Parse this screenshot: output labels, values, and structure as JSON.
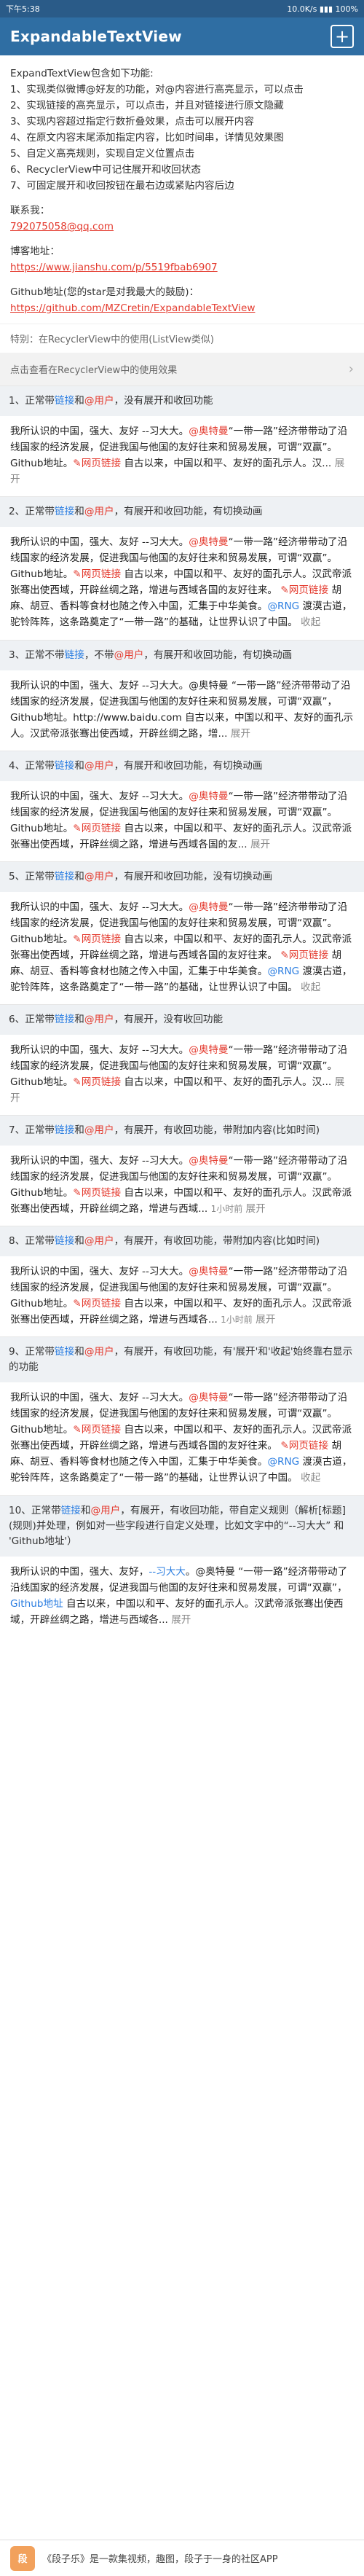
{
  "status": {
    "time": "下午5:38",
    "network": "10.0K/s",
    "battery": "100%"
  },
  "app": {
    "title": "ExpandableTextView"
  },
  "intro": {
    "heading": "ExpandTextView包含如下功能:",
    "lines": [
      "1、实现类似微博@好友的功能，对@内容进行高亮显示，可以点击",
      "2、实现链接的高亮显示，可以点击，并且对链接进行原文隐藏",
      "3、实现内容超过指定行数折叠效果，点击可以展开内容",
      "4、在原文内容末尾添加指定内容，比如时间串，详情见效果图",
      "5、自定义高亮规则，实现自定义位置点击",
      "6、RecyclerView中可记住展开和收回状态",
      "7、可固定展开和收回按钮在最右边或紧贴内容后边"
    ],
    "contact_label": "联系我：",
    "contact_email": "792075058@qq.com",
    "blog_label": "博客地址：",
    "blog_url": "https://www.jianshu.com/p/5519fbab6907",
    "github_label": "Github地址(您的star是对我最大的鼓励)：",
    "github_url": "https://github.com/MZCretin/ExpandableTextView"
  },
  "special_hint": "特别：在RecyclerView中的使用(ListView类似)",
  "rv_button": "点击查看在RecyclerView中的使用效果",
  "items": [
    {
      "hdr_prefix": "1、正常带",
      "hdr_link": "链接",
      "hdr_and": "和",
      "hdr_at": "@用户",
      "hdr_rest": "，没有展开和收回功能",
      "body_a": "我所认识的中国，强大、友好 --习大大。",
      "body_b": "@奥特曼",
      "body_c": "“一带一路”经济带带动了沿线国家的经济发展，促进我国与他国的友好往来和贸易发展，可谓“双赢”。Github地址。",
      "body_d": "网页链接",
      "body_e": "自古以来，中国以和平、友好的面孔示人。汉...",
      "body_tail": "展开"
    },
    {
      "hdr_prefix": "2、正常带",
      "hdr_link": "链接",
      "hdr_and": "和",
      "hdr_at": "@用户",
      "hdr_rest": "，有展开和收回功能，有切换动画",
      "body_a": "我所认识的中国，强大、友好 --习大大。",
      "body_b": "@奥特曼",
      "body_c": "“一带一路”经济带带动了沿线国家的经济发展，促进我国与他国的友好往来和贸易发展，可谓“双赢”。Github地址。",
      "body_d": "网页链接",
      "body_e": "自古以来，中国以和平、友好的面孔示人。汉武帝派张骞出使西域，开辟丝绸之路，增进与西域各国的友好往来。",
      "body_d2": "网页链接",
      "body_f": "胡麻、胡豆、香料等食材也随之传入中国，汇集于中华美食。",
      "body_g": "@RNG",
      "body_h": "渡漠古道，驼铃阵阵，这条路奠定了“一带一路”的基础，让世界认识了中国。",
      "body_tail": "收起"
    },
    {
      "hdr_prefix": "3、正常不带",
      "hdr_link": "链接",
      "hdr_and": "，不带",
      "hdr_at": "@用户",
      "hdr_rest": "，有展开和收回功能，有切换动画",
      "body_a": "我所认识的中国，强大、友好 --习大大。@奥特曼 “一带一路”经济带带动了沿线国家的经济发展，促进我国与他国的友好往来和贸易发展，可谓“双赢”，Github地址。http://www.baidu.com 自古以来，中国以和平、友好的面孔示人。汉武帝派张骞出使西域，开辟丝绸之路，增...",
      "body_tail": "展开"
    },
    {
      "hdr_prefix": "4、正常带",
      "hdr_link": "链接",
      "hdr_and": "和",
      "hdr_at": "@用户",
      "hdr_rest": "，有展开和收回功能，有切换动画",
      "body_a": "我所认识的中国，强大、友好 --习大大。",
      "body_b": "@奥特曼",
      "body_c": "“一带一路”经济带带动了沿线国家的经济发展，促进我国与他国的友好往来和贸易发展，可谓“双赢”。Github地址。",
      "body_d": "网页链接",
      "body_e": "自古以来，中国以和平、友好的面孔示人。汉武帝派张骞出使西域，开辟丝绸之路，增进与西域各国的友...",
      "body_tail": "展开"
    },
    {
      "hdr_prefix": "5、正常带",
      "hdr_link": "链接",
      "hdr_and": "和",
      "hdr_at": "@用户",
      "hdr_rest": "，有展开和收回功能，没有切换动画",
      "body_a": "我所认识的中国，强大、友好 --习大大。",
      "body_b": "@奥特曼",
      "body_c": "“一带一路”经济带带动了沿线国家的经济发展，促进我国与他国的友好往来和贸易发展，可谓“双赢”。Github地址。",
      "body_d": "网页链接",
      "body_e": "自古以来，中国以和平、友好的面孔示人。汉武帝派张骞出使西域，开辟丝绸之路，增进与西域各国的友好往来。",
      "body_d2": "网页链接",
      "body_f": "胡麻、胡豆、香料等食材也随之传入中国，汇集于中华美食。",
      "body_g": "@RNG",
      "body_h": "渡漠古道，驼铃阵阵，这条路奠定了“一带一路”的基础，让世界认识了中国。",
      "body_tail": "收起"
    },
    {
      "hdr_prefix": "6、正常带",
      "hdr_link": "链接",
      "hdr_and": "和",
      "hdr_at": "@用户",
      "hdr_rest": "，有展开，没有收回功能",
      "body_a": "我所认识的中国，强大、友好 --习大大。",
      "body_b": "@奥特曼",
      "body_c": "“一带一路”经济带带动了沿线国家的经济发展，促进我国与他国的友好往来和贸易发展，可谓“双赢”。Github地址。",
      "body_d": "网页链接",
      "body_e": "自古以来，中国以和平、友好的面孔示人。汉...",
      "body_tail": "展开"
    },
    {
      "hdr_prefix": "7、正常带",
      "hdr_link": "链接",
      "hdr_and": "和",
      "hdr_at": "@用户",
      "hdr_rest": "，有展开，有收回功能，带附加内容(比如时间)",
      "body_a": "我所认识的中国，强大、友好 --习大大。",
      "body_b": "@奥特曼",
      "body_c": "“一带一路”经济带带动了沿线国家的经济发展，促进我国与他国的友好往来和贸易发展，可谓“双赢”。Github地址。",
      "body_d": "网页链接",
      "body_e": "自古以来，中国以和平、友好的面孔示人。汉武帝派张骞出使西域，开辟丝绸之路，增进与西域...",
      "body_time": "1小时前",
      "body_tail": "展开"
    },
    {
      "hdr_prefix": "8、正常带",
      "hdr_link": "链接",
      "hdr_and": "和",
      "hdr_at": "@用户",
      "hdr_rest": "，有展开，有收回功能，带附加内容(比如时间)",
      "body_a": "我所认识的中国，强大、友好 --习大大。",
      "body_b": "@奥特曼",
      "body_c": "“一带一路”经济带带动了沿线国家的经济发展，促进我国与他国的友好往来和贸易发展，可谓“双赢”。Github地址。",
      "body_d": "网页链接",
      "body_e": "自古以来，中国以和平、友好的面孔示人。汉武帝派张骞出使西域，开辟丝绸之路，增进与西域各...",
      "body_time": "1小时前",
      "body_tail": "展开"
    },
    {
      "hdr_prefix": "9、正常带",
      "hdr_link": "链接",
      "hdr_and": "和",
      "hdr_at": "@用户",
      "hdr_rest": "，有展开，有收回功能，有'展开'和'收起'始终靠右显示的功能",
      "body_a": "我所认识的中国，强大、友好 --习大大。",
      "body_b": "@奥特曼",
      "body_c": "“一带一路”经济带带动了沿线国家的经济发展，促进我国与他国的友好往来和贸易发展，可谓“双赢”。Github地址。",
      "body_d": "网页链接",
      "body_e": "自古以来，中国以和平、友好的面孔示人。汉武帝派张骞出使西域，开辟丝绸之路，增进与西域各国的友好往来。",
      "body_d2": "网页链接",
      "body_f": "胡麻、胡豆、香料等食材也随之传入中国，汇集于中华美食。",
      "body_g": "@RNG",
      "body_h": "渡漠古道，驼铃阵阵，这条路奠定了“一带一路”的基础，让世界认识了中国。",
      "body_tail": "收起"
    },
    {
      "hdr_prefix": "10、正常带",
      "hdr_link": "链接",
      "hdr_and": "和",
      "hdr_at": "@用户",
      "hdr_rest": "，有展开，有收回功能，带自定义规则（解析[标题](规则)并处理，例如对一些字段进行自定义处理，比如文字中的“--习大大” 和 'Github地址'）",
      "body_a": "我所认识的中国，强大、友好，",
      "body_b": "--习大大",
      "body_c": "。@奥特曼 “一带一路”经济带带动了沿线国家的经济发展，促进我国与他国的友好往来和贸易发展，可谓“双赢”，",
      "body_d": "Github地址",
      "body_e": " 自古以来，中国以和平、友好的面孔示人。汉武帝派张骞出使西域，开辟丝绸之路，增进与西域各...",
      "body_tail": "展开"
    }
  ],
  "ad": {
    "text": "《段子乐》是一款集视频，趣图，段子于一身的社区APP"
  },
  "colors": {
    "primary": "#2f6ea3",
    "link": "#2a7de1",
    "at": "#e43b2f"
  }
}
